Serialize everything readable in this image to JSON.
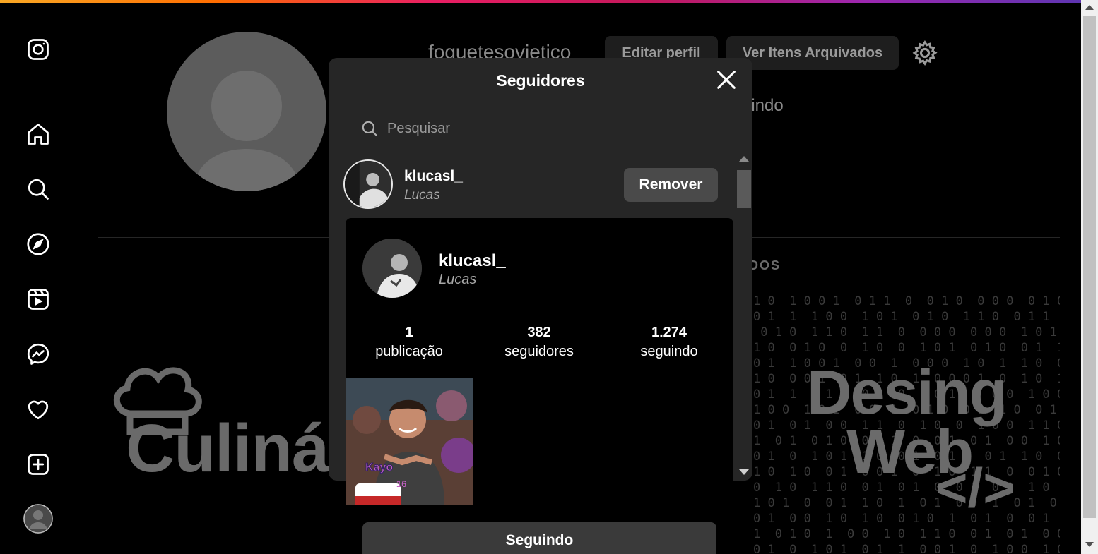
{
  "colors": {
    "background": "#000000",
    "modal": "#262626",
    "button": "#4a4a4a",
    "muted_text": "#a8a8a8"
  },
  "sidebar": {
    "items": [
      {
        "icon": "instagram-logo-icon"
      },
      {
        "icon": "home-icon"
      },
      {
        "icon": "search-icon"
      },
      {
        "icon": "explore-compass-icon"
      },
      {
        "icon": "reels-icon"
      },
      {
        "icon": "messenger-icon"
      },
      {
        "icon": "heart-icon"
      },
      {
        "icon": "create-plus-icon"
      },
      {
        "icon": "profile-avatar-icon"
      }
    ]
  },
  "profile": {
    "username": "foguetesovietico",
    "edit_button": "Editar perfil",
    "archive_button": "Ver Itens Arquivados",
    "stats_fragment": "uindo",
    "tab_fragment": "DOS",
    "post_1_text": "Culinár",
    "post_2_title_line1": "Desing",
    "post_2_title_line2": "Web",
    "post_2_code": "</>"
  },
  "modal": {
    "title": "Seguidores",
    "search_placeholder": "Pesquisar",
    "followers": [
      {
        "username": "klucasl_",
        "name": "Lucas",
        "action": "Remover"
      }
    ]
  },
  "hover_card": {
    "username": "klucasl_",
    "name": "Lucas",
    "stats": [
      {
        "value": "1",
        "label": "publicação"
      },
      {
        "value": "382",
        "label": "seguidores"
      },
      {
        "value": "1.274",
        "label": "seguindo"
      }
    ],
    "post_caption": "Kayo",
    "post_number": "16",
    "follow_button": "Seguindo"
  }
}
